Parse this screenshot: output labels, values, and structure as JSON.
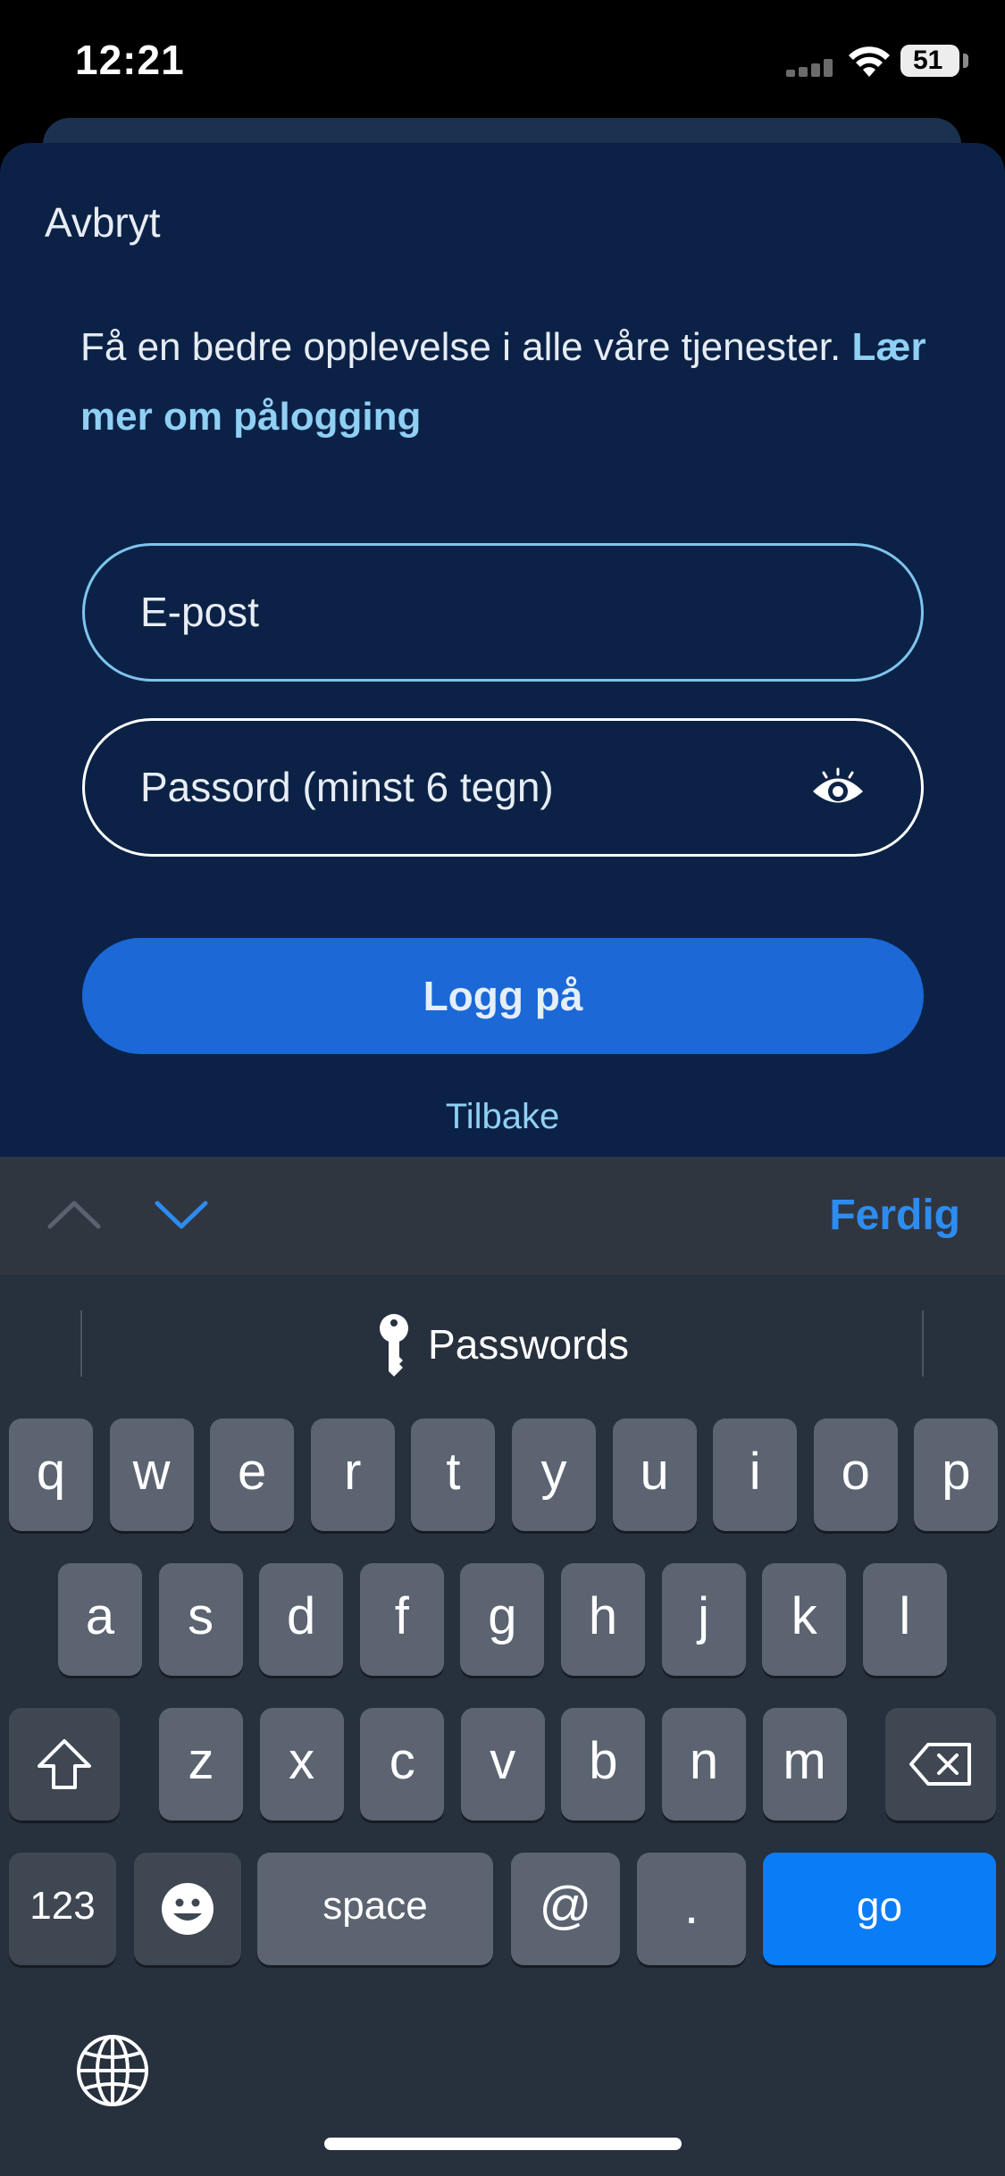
{
  "status_bar": {
    "time": "12:21",
    "battery": "51"
  },
  "sheet": {
    "cancel_label": "Avbryt",
    "intro_text": "Få en bedre opplevelse i alle våre tjenester.",
    "intro_link": "Lær mer om pålogging",
    "email_placeholder": "E-post",
    "password_placeholder": "Passord (minst 6 tegn)",
    "login_button": "Logg på",
    "back_link": "Tilbake"
  },
  "toolbar": {
    "done_label": "Ferdig"
  },
  "keyboard": {
    "quicktype": "Passwords",
    "row1": [
      "q",
      "w",
      "e",
      "r",
      "t",
      "y",
      "u",
      "i",
      "o",
      "p"
    ],
    "row2": [
      "a",
      "s",
      "d",
      "f",
      "g",
      "h",
      "j",
      "k",
      "l"
    ],
    "row3": [
      "z",
      "x",
      "c",
      "v",
      "b",
      "n",
      "m"
    ],
    "numbers_key": "123",
    "space_key": "space",
    "at_key": "@",
    "dot_key": ".",
    "go_key": "go"
  },
  "colors": {
    "sheet_bg": "#0b2246",
    "accent": "#1b68d6",
    "link": "#8fd0f4",
    "go_key": "#0a7cf6"
  }
}
